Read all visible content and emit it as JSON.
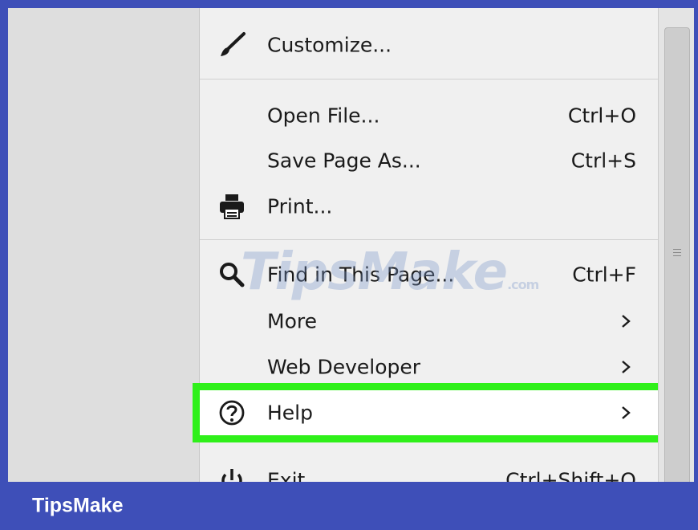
{
  "menu": {
    "customize": {
      "label": "Customize...",
      "icon": "paintbrush-icon"
    },
    "open_file": {
      "label": "Open File...",
      "shortcut": "Ctrl+O"
    },
    "save_page": {
      "label": "Save Page As...",
      "shortcut": "Ctrl+S"
    },
    "print": {
      "label": "Print...",
      "icon": "printer-icon"
    },
    "find": {
      "label": "Find in This Page...",
      "shortcut": "Ctrl+F",
      "icon": "search-icon"
    },
    "more": {
      "label": "More"
    },
    "web_developer": {
      "label": "Web Developer"
    },
    "help": {
      "label": "Help",
      "icon": "question-circle-icon"
    },
    "exit": {
      "label": "Exit",
      "shortcut": "Ctrl+Shift+Q",
      "icon": "power-icon"
    }
  },
  "highlight_color": "#2ff01a",
  "watermark": {
    "text": "TipsMake",
    "suffix": ".com"
  },
  "footer": {
    "brand": "TipsMake",
    "background": "#3e4fb8"
  }
}
